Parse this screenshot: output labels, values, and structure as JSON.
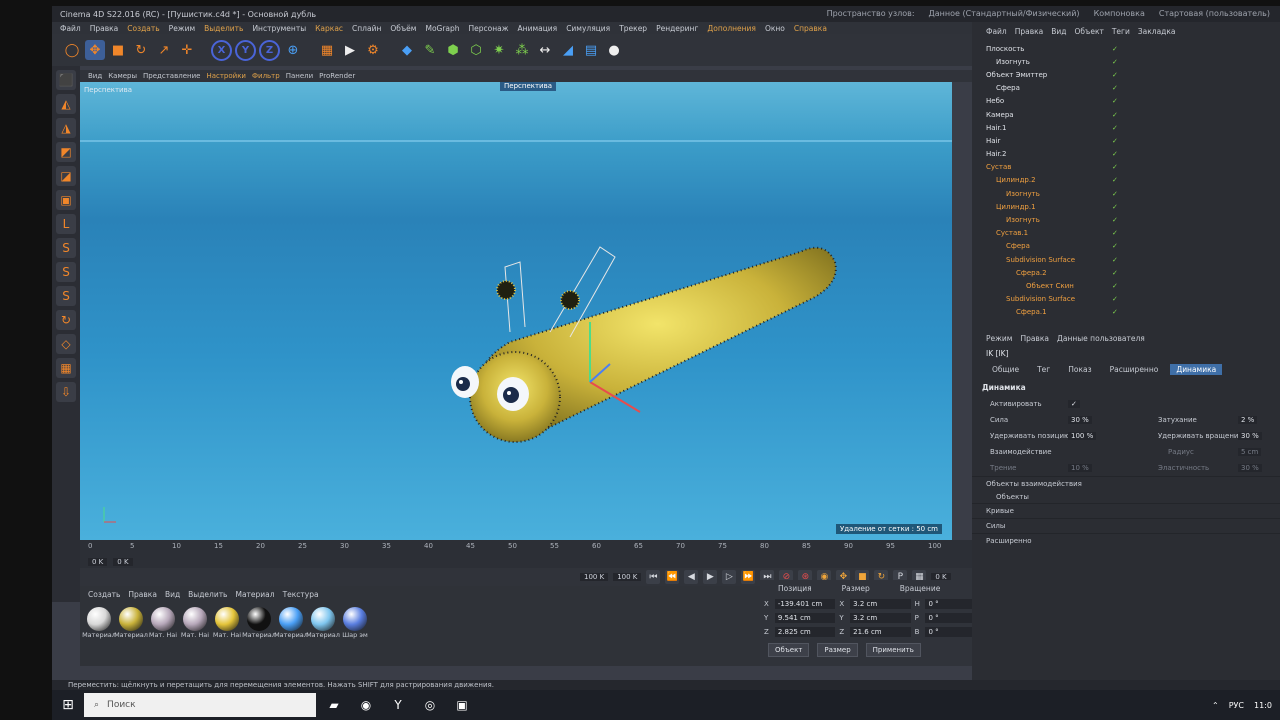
{
  "window": {
    "title": "Cinema 4D S22.016 (RC) - [Пушистик.c4d *] - Основной дубль",
    "layout_label": "Пространство узлов:",
    "layout_value": "Данное (Стандартный/Физический)",
    "tab1": "Компоновка",
    "tab2": "Стартовая (пользователь)"
  },
  "menu": [
    "Файл",
    "Правка",
    "Создать",
    "Режим",
    "Выделить",
    "Инструменты",
    "Каркас",
    "Сплайн",
    "Объём",
    "MoGraph",
    "Персонаж",
    "Анимация",
    "Симуляция",
    "Трекер",
    "Рендеринг",
    "Дополнения",
    "Окно",
    "Справка"
  ],
  "viewport_menu": [
    "Вид",
    "Камеры",
    "Представление",
    "Настройки",
    "Фильтр",
    "Панели",
    "ProRender"
  ],
  "viewport": {
    "label": "Перспектива",
    "corner": "Перспектива",
    "scale": "Удаление от сетки : 50 cm"
  },
  "timeline": {
    "ticks": [
      "0",
      "5",
      "10",
      "15",
      "20",
      "25",
      "30",
      "35",
      "40",
      "45",
      "50",
      "55",
      "60",
      "65",
      "70",
      "75",
      "80",
      "85",
      "90",
      "95",
      "100"
    ],
    "frame_start": "0 K",
    "frame_cur": "0 K",
    "frame_end": "100 K",
    "frame_end2": "100 K",
    "frame_right": "0 K"
  },
  "materials": {
    "menu": [
      "Создать",
      "Правка",
      "Вид",
      "Выделить",
      "Материал",
      "Текстура"
    ],
    "items": [
      {
        "name": "Материал",
        "color": "#d8d8d8"
      },
      {
        "name": "Материал",
        "color": "#c9b23a"
      },
      {
        "name": "Мат. Наі",
        "color": "#b7a8ba"
      },
      {
        "name": "Мат. Наі",
        "color": "#b7a8ba"
      },
      {
        "name": "Мат. Наі",
        "color": "#e4c43a"
      },
      {
        "name": "Материал",
        "color": "#111111"
      },
      {
        "name": "Материал",
        "color": "#4a9ff5"
      },
      {
        "name": "Материал",
        "color": "#7fc6ef"
      },
      {
        "name": "Шар эм",
        "color": "#5a7ee0"
      }
    ]
  },
  "coords": {
    "headers": [
      "Позиция",
      "Размер",
      "Вращение"
    ],
    "rows": [
      {
        "axis": "X",
        "pos": "-139.401 cm",
        "size_axis": "X",
        "size": "3.2 cm",
        "rot_axis": "H",
        "rot": "0 °"
      },
      {
        "axis": "Y",
        "pos": "9.541 cm",
        "size_axis": "Y",
        "size": "3.2 cm",
        "rot_axis": "P",
        "rot": "0 °"
      },
      {
        "axis": "Z",
        "pos": "2.825 cm",
        "size_axis": "Z",
        "size": "21.6 cm",
        "rot_axis": "B",
        "rot": "0 °"
      }
    ],
    "mode": "Объект",
    "size_mode": "Размер",
    "apply": "Применить"
  },
  "status": "Переместить: щёлкнуть и перетащить для перемещения элементов. Нажать SHIFT для растрирования движения.",
  "objects_menu": [
    "Файл",
    "Правка",
    "Вид",
    "Объект",
    "Теги",
    "Закладка"
  ],
  "objects": [
    {
      "name": "Плоскость",
      "indent": 0,
      "orange": false
    },
    {
      "name": "Изогнуть",
      "indent": 1,
      "orange": false
    },
    {
      "name": "Объект Эмиттер",
      "indent": 0,
      "orange": false
    },
    {
      "name": "Сфера",
      "indent": 1,
      "orange": false
    },
    {
      "name": "Небо",
      "indent": 0,
      "orange": false
    },
    {
      "name": "Камера",
      "indent": 0,
      "orange": false
    },
    {
      "name": "Hair.1",
      "indent": 0,
      "orange": false
    },
    {
      "name": "Hair",
      "indent": 0,
      "orange": false
    },
    {
      "name": "Hair.2",
      "indent": 0,
      "orange": false
    },
    {
      "name": "Сустав",
      "indent": 0,
      "orange": true
    },
    {
      "name": "Цилиндр.2",
      "indent": 1,
      "orange": true
    },
    {
      "name": "Изогнуть",
      "indent": 2,
      "orange": true
    },
    {
      "name": "Цилиндр.1",
      "indent": 1,
      "orange": true
    },
    {
      "name": "Изогнуть",
      "indent": 2,
      "orange": true
    },
    {
      "name": "Сустав.1",
      "indent": 1,
      "orange": true
    },
    {
      "name": "Сфера",
      "indent": 2,
      "orange": true
    },
    {
      "name": "Subdivision Surface",
      "indent": 2,
      "orange": true
    },
    {
      "name": "Сфера.2",
      "indent": 3,
      "orange": true
    },
    {
      "name": "Объект Скин",
      "indent": 4,
      "orange": true
    },
    {
      "name": "Subdivision Surface",
      "indent": 2,
      "orange": true
    },
    {
      "name": "Сфера.1",
      "indent": 3,
      "orange": true
    }
  ],
  "attr": {
    "menu": [
      "Режим",
      "Правка",
      "Данные пользователя"
    ],
    "title": "IK [IK]",
    "tabs": [
      "Общие",
      "Тег",
      "Показ",
      "Расширенно",
      "Динамика"
    ],
    "section": "Динамика",
    "activate": "Активировать",
    "force": "Сила",
    "force_val": "30 %",
    "damping": "Затухание",
    "damping_val": "2 %",
    "hold_pos": "Удерживать позицию",
    "hold_pos_val": "100 %",
    "hold_rot": "Удерживать вращение",
    "hold_rot_val": "30 %",
    "interact": "Взаимодействие",
    "radius": "Радиус",
    "radius_val": "5 cm",
    "friction": "Трение",
    "friction_val": "10 %",
    "elastic": "Эластичность",
    "elastic_val": "30 %",
    "objects_group": "Объекты взаимодействия",
    "objects_btn": "Объекты",
    "curves": "Кривые",
    "forces": "Силы",
    "advanced": "Расширенно"
  },
  "taskbar": {
    "search": "Поиск",
    "lang": "РУС",
    "time": "11:0"
  }
}
